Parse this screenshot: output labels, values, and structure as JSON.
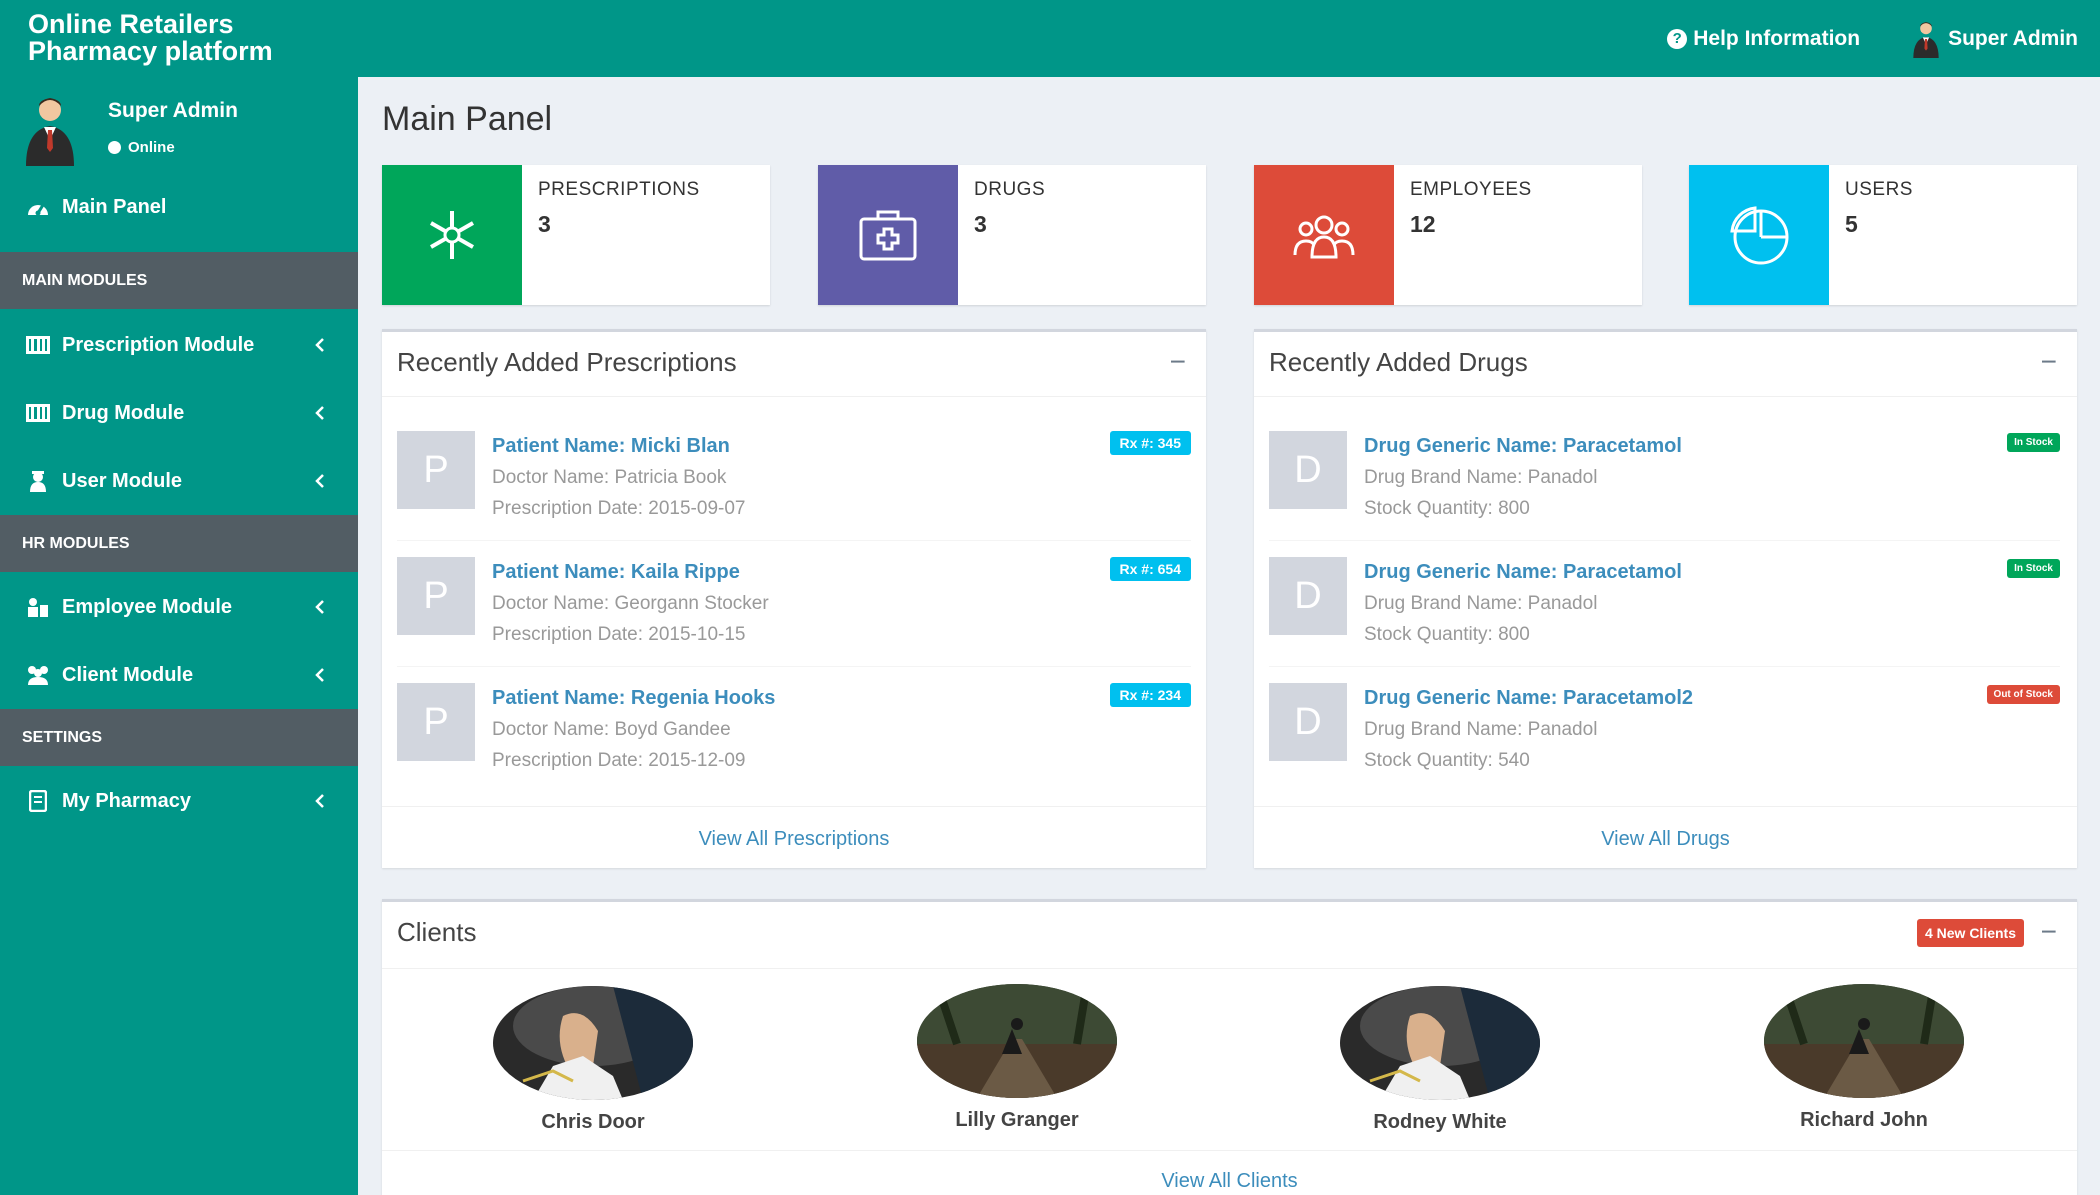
{
  "brand": {
    "line1": "Online Retailers",
    "line2": "Pharmacy platform"
  },
  "topbar": {
    "help": "Help Information",
    "user": "Super Admin"
  },
  "sidebar": {
    "user_name": "Super Admin",
    "status": "Online",
    "main_panel": "Main Panel",
    "headers": {
      "main": "MAIN MODULES",
      "hr": "HR MODULES",
      "settings": "SETTINGS"
    },
    "items": {
      "prescription": "Prescription Module",
      "drug": "Drug Module",
      "user": "User Module",
      "employee": "Employee Module",
      "client": "Client Module",
      "pharmacy": "My Pharmacy"
    }
  },
  "page_title": "Main Panel",
  "stats": {
    "prescriptions": {
      "label": "PRESCRIPTIONS",
      "value": "3",
      "color": "#00a65a"
    },
    "drugs": {
      "label": "DRUGS",
      "value": "3",
      "color": "#605ca8"
    },
    "employees": {
      "label": "EMPLOYEES",
      "value": "12",
      "color": "#dd4b39"
    },
    "users": {
      "label": "USERS",
      "value": "5",
      "color": "#00c0ef"
    }
  },
  "prescriptions_panel": {
    "title": "Recently Added Prescriptions",
    "thumb": "P",
    "footer": "View All Prescriptions",
    "items": [
      {
        "patient": "Patient Name: Micki Blan",
        "doctor": "Doctor Name: Patricia Book",
        "date": "Prescription Date: 2015-09-07",
        "badge": "Rx #: 345"
      },
      {
        "patient": "Patient Name: Kaila Rippe",
        "doctor": "Doctor Name: Georgann Stocker",
        "date": "Prescription Date: 2015-10-15",
        "badge": "Rx #: 654"
      },
      {
        "patient": "Patient Name: Regenia Hooks",
        "doctor": "Doctor Name: Boyd Gandee",
        "date": "Prescription Date: 2015-12-09",
        "badge": "Rx #: 234"
      }
    ]
  },
  "drugs_panel": {
    "title": "Recently Added Drugs",
    "thumb": "D",
    "footer": "View All Drugs",
    "items": [
      {
        "generic": "Drug Generic Name: Paracetamol",
        "brand": "Drug Brand Name: Panadol",
        "stock": "Stock Quantity: 800",
        "badge": "In Stock"
      },
      {
        "generic": "Drug Generic Name: Paracetamol",
        "brand": "Drug Brand Name: Panadol",
        "stock": "Stock Quantity: 800",
        "badge": "In Stock"
      },
      {
        "generic": "Drug Generic Name: Paracetamol2",
        "brand": "Drug Brand Name: Panadol",
        "stock": "Stock Quantity: 540",
        "badge": "Out of Stock"
      }
    ]
  },
  "clients_panel": {
    "title": "Clients",
    "badge": "4 New Clients",
    "footer": "View All Clients",
    "clients": [
      {
        "name": "Chris Door"
      },
      {
        "name": "Lilly Granger"
      },
      {
        "name": "Rodney White"
      },
      {
        "name": "Richard John"
      }
    ]
  },
  "colors": {
    "brand": "#009688",
    "sidebar_header": "#525d64",
    "link": "#3c8dbc"
  }
}
